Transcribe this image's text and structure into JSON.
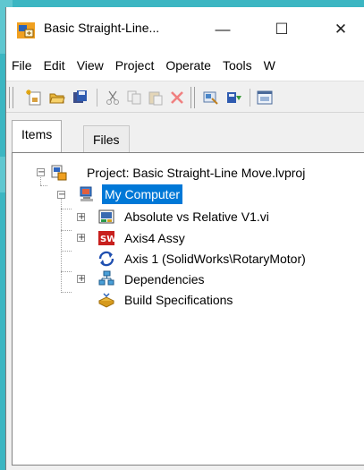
{
  "window": {
    "title": "Basic Straight-Line...",
    "minimize_glyph": "—",
    "maximize_glyph": "☐",
    "close_glyph": "✕"
  },
  "menu": [
    "File",
    "Edit",
    "View",
    "Project",
    "Operate",
    "Tools",
    "W"
  ],
  "toolbar_icons": [
    "new-vi-icon",
    "open-folder-icon",
    "save-all-icon",
    "cut-icon",
    "copy-icon",
    "paste-icon",
    "delete-icon",
    "build-icon",
    "deploy-icon",
    "window-icon"
  ],
  "tabs": [
    {
      "label": "Items",
      "active": true
    },
    {
      "label": "Files",
      "active": false
    }
  ],
  "tree": {
    "project": {
      "label": "Project: Basic Straight-Line Move.lvproj",
      "icon": "project-icon",
      "expander": "−"
    },
    "computer": {
      "label": "My Computer",
      "icon": "computer-icon",
      "expander": "−",
      "selected": true
    },
    "children": [
      {
        "label": "Absolute vs Relative V1.vi",
        "icon": "vi-icon",
        "expander": "+"
      },
      {
        "label": "Axis4 Assy",
        "icon": "solidworks-assembly-icon",
        "expander": "+"
      },
      {
        "label": "Axis 1 (SolidWorks\\RotaryMotor)",
        "icon": "axis-icon",
        "expander": ""
      },
      {
        "label": "Dependencies",
        "icon": "dependencies-icon",
        "expander": "+"
      },
      {
        "label": "Build Specifications",
        "icon": "build-specifications-icon",
        "expander": ""
      }
    ]
  },
  "colors": {
    "background": "#3cb6c2",
    "selection": "#0078d7",
    "window": "#f0f0f0"
  }
}
